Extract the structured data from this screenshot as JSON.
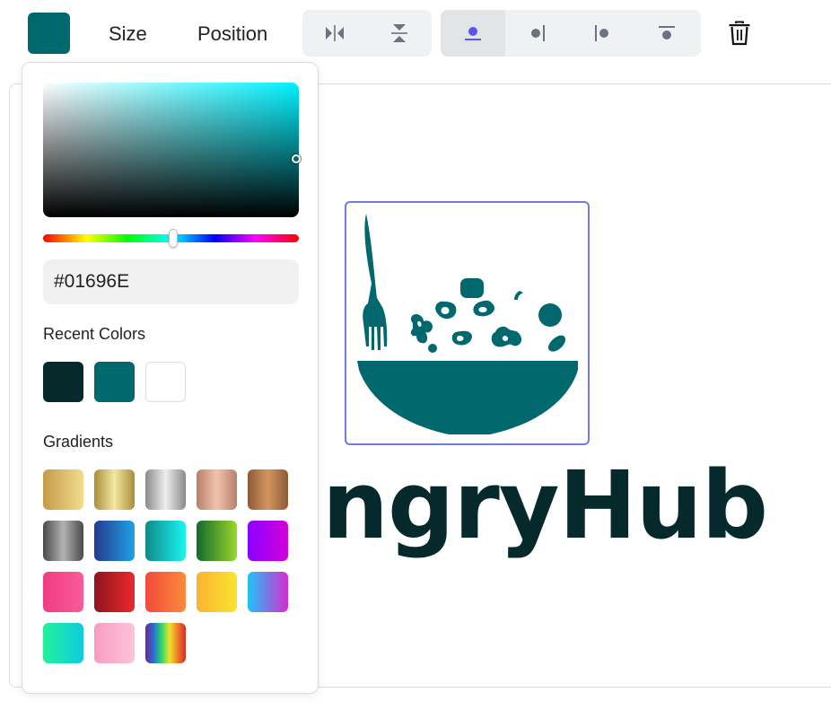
{
  "toolbar": {
    "current_color": "#01696E",
    "size_label": "Size",
    "position_label": "Position",
    "flip_icons": [
      "flip-horizontal-icon",
      "flip-vertical-icon"
    ],
    "align_icons": [
      "align-center-icon",
      "align-right-icon",
      "align-left-icon",
      "align-top-icon"
    ],
    "delete_icon": "trash-icon"
  },
  "canvas": {
    "brand_text": "ngryHub",
    "logo_icon": "salad-bowl-with-fork-icon",
    "logo_color": "#01696E",
    "brand_color": "#06292B"
  },
  "picker": {
    "hex_value": "#01696E",
    "recent_label": "Recent Colors",
    "recent_colors": [
      "#062A2B",
      "#01696E",
      "#FFFFFF"
    ],
    "gradients_label": "Gradients",
    "gradients": [
      "linear-gradient(90deg,#c59b4a,#f2dd8e)",
      "linear-gradient(90deg,#a98e3c,#f4e7a0,#a98e3c)",
      "linear-gradient(90deg,#8a8a8a,#eeeeee,#8a8a8a)",
      "linear-gradient(90deg,#b87f6a,#f1c4ae,#b87f6a)",
      "linear-gradient(90deg,#8d5a37,#d3955d,#8d5a37)",
      "linear-gradient(90deg,#4a4a4a,#b3b3b3,#4a4a4a)",
      "linear-gradient(90deg,#253a8e,#1fa2e6)",
      "linear-gradient(90deg,#0f8a8a,#19f5f0)",
      "linear-gradient(90deg,#136a2a,#9bd62d)",
      "linear-gradient(90deg,#8a00ff,#d300d9)",
      "linear-gradient(90deg,#f13c82,#f95b9b)",
      "linear-gradient(90deg,#8f1420,#ea2a2a)",
      "linear-gradient(90deg,#f14a3c,#fd8a3a)",
      "linear-gradient(90deg,#fbb431,#f8e52f)",
      "linear-gradient(90deg,#1fc4f6,#d82bd0)",
      "linear-gradient(90deg,#23f19a,#0fcbe0)",
      "linear-gradient(90deg,#f79cc4,#ffc4d8)",
      "linear-gradient(90deg,#6a2b8a,#2a6ad8,#2ad86a,#f0e22a,#f07a2a,#d82a2a)"
    ]
  }
}
